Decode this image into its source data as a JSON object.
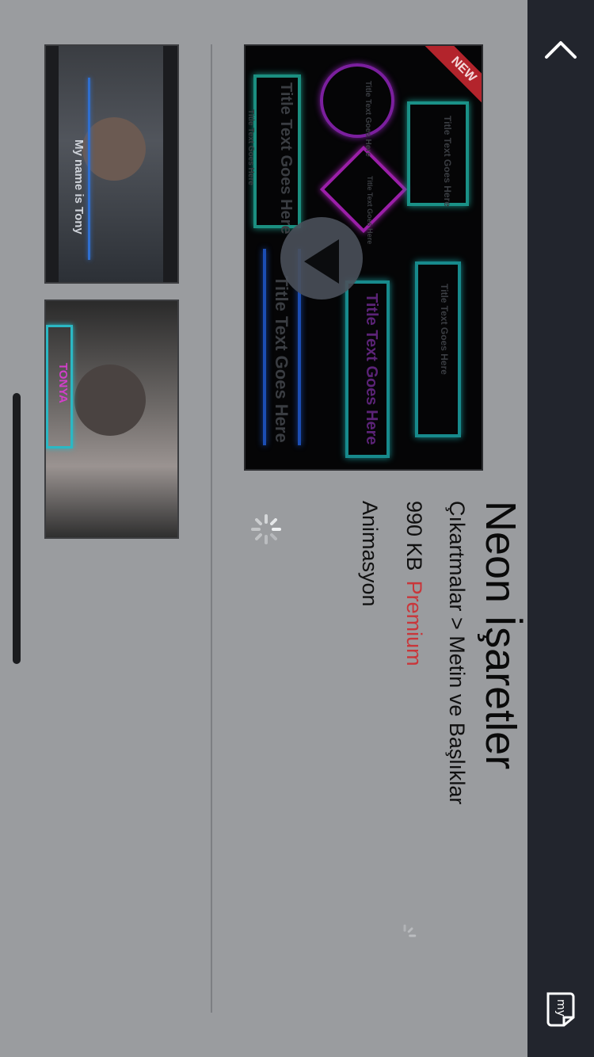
{
  "nav": {
    "collapse_icon": "chevron-up-icon",
    "brand_icon": "my-icon",
    "brand_icon_text": "my"
  },
  "preview": {
    "badge": "NEW",
    "play_icon": "play-icon",
    "neon_texts": [
      "Title Text Goes Here",
      "Title Text Goes Here",
      "Title Text Goes Here",
      "Title Text Goes Here",
      "Title Text Goes Here",
      "Title Text Goes Here",
      "Title Text Goes Here",
      "Title Text Goes Here"
    ]
  },
  "item": {
    "title": "Neon İşaretler",
    "category": "Çıkartmalar > Metin ve Başlıklar",
    "size": "990 KB",
    "tier": "Premium",
    "type": "Animasyon"
  },
  "thumbnails": [
    {
      "caption": "My name is Tony"
    },
    {
      "caption": "TONYA"
    }
  ],
  "colors": {
    "background": "#9a9c9f",
    "sidebar": "#22252d",
    "premium": "#c9363a",
    "badge": "#b3242c"
  }
}
